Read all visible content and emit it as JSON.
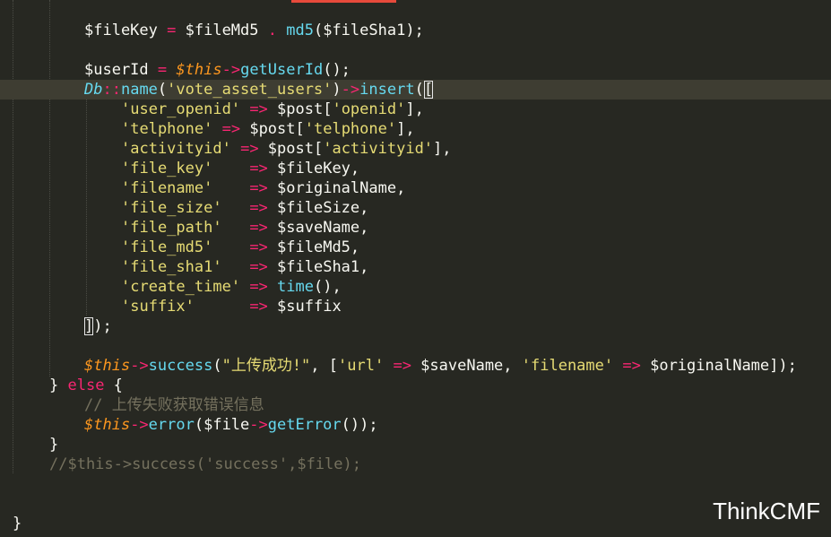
{
  "watermark": "ThinkCMF",
  "colors": {
    "background": "#272822",
    "active_line": "#3e3d32",
    "operator": "#f92672",
    "function": "#66d9ef",
    "string": "#e6db74",
    "this_var": "#fd971f",
    "comment": "#75715e",
    "plain": "#f8f8f2"
  },
  "code": {
    "l01": [
      {
        "text": "$fileKey",
        "cls": "v"
      },
      {
        "text": " ",
        "cls": "v"
      },
      {
        "text": "=",
        "cls": "op"
      },
      {
        "text": " $fileMd5 ",
        "cls": "v"
      },
      {
        "text": ".",
        "cls": "op"
      },
      {
        "text": " ",
        "cls": "v"
      },
      {
        "text": "md5",
        "cls": "fn"
      },
      {
        "text": "($fileSha1);",
        "cls": "v"
      }
    ],
    "l02": [
      {
        "text": "$userId",
        "cls": "v"
      },
      {
        "text": " ",
        "cls": "v"
      },
      {
        "text": "=",
        "cls": "op"
      },
      {
        "text": " ",
        "cls": "v"
      },
      {
        "text": "$this",
        "cls": "this"
      },
      {
        "text": "->",
        "cls": "op"
      },
      {
        "text": "getUserId",
        "cls": "fn"
      },
      {
        "text": "();",
        "cls": "v"
      }
    ],
    "l03": [
      {
        "text": "Db",
        "cls": "cls"
      },
      {
        "text": "::",
        "cls": "op"
      },
      {
        "text": "name",
        "cls": "fn"
      },
      {
        "text": "(",
        "cls": "v"
      },
      {
        "text": "'vote_asset_users'",
        "cls": "str"
      },
      {
        "text": ")",
        "cls": "v"
      },
      {
        "text": "->",
        "cls": "op"
      },
      {
        "text": "insert",
        "cls": "fn"
      },
      {
        "text": "(",
        "cls": "v"
      },
      {
        "text": "[",
        "cls": "brk"
      }
    ],
    "l04": [
      {
        "text": "'user_openid'",
        "cls": "str"
      },
      {
        "text": " ",
        "cls": "v"
      },
      {
        "text": "=>",
        "cls": "op"
      },
      {
        "text": " $post[",
        "cls": "v"
      },
      {
        "text": "'openid'",
        "cls": "str"
      },
      {
        "text": "],",
        "cls": "v"
      }
    ],
    "l05": [
      {
        "text": "'telphone'",
        "cls": "str"
      },
      {
        "text": " ",
        "cls": "v"
      },
      {
        "text": "=>",
        "cls": "op"
      },
      {
        "text": " $post[",
        "cls": "v"
      },
      {
        "text": "'telphone'",
        "cls": "str"
      },
      {
        "text": "],",
        "cls": "v"
      }
    ],
    "l06": [
      {
        "text": "'activityid'",
        "cls": "str"
      },
      {
        "text": " ",
        "cls": "v"
      },
      {
        "text": "=>",
        "cls": "op"
      },
      {
        "text": " $post[",
        "cls": "v"
      },
      {
        "text": "'activityid'",
        "cls": "str"
      },
      {
        "text": "],",
        "cls": "v"
      }
    ],
    "l07": [
      {
        "text": "'file_key'",
        "cls": "str"
      },
      {
        "text": "    ",
        "cls": "v"
      },
      {
        "text": "=>",
        "cls": "op"
      },
      {
        "text": " $fileKey,",
        "cls": "v"
      }
    ],
    "l08": [
      {
        "text": "'filename'",
        "cls": "str"
      },
      {
        "text": "    ",
        "cls": "v"
      },
      {
        "text": "=>",
        "cls": "op"
      },
      {
        "text": " $originalName,",
        "cls": "v"
      }
    ],
    "l09": [
      {
        "text": "'file_size'",
        "cls": "str"
      },
      {
        "text": "   ",
        "cls": "v"
      },
      {
        "text": "=>",
        "cls": "op"
      },
      {
        "text": " $fileSize,",
        "cls": "v"
      }
    ],
    "l10": [
      {
        "text": "'file_path'",
        "cls": "str"
      },
      {
        "text": "   ",
        "cls": "v"
      },
      {
        "text": "=>",
        "cls": "op"
      },
      {
        "text": " $saveName,",
        "cls": "v"
      }
    ],
    "l11": [
      {
        "text": "'file_md5'",
        "cls": "str"
      },
      {
        "text": "    ",
        "cls": "v"
      },
      {
        "text": "=>",
        "cls": "op"
      },
      {
        "text": " $fileMd5,",
        "cls": "v"
      }
    ],
    "l12": [
      {
        "text": "'file_sha1'",
        "cls": "str"
      },
      {
        "text": "   ",
        "cls": "v"
      },
      {
        "text": "=>",
        "cls": "op"
      },
      {
        "text": " $fileSha1,",
        "cls": "v"
      }
    ],
    "l13": [
      {
        "text": "'create_time'",
        "cls": "str"
      },
      {
        "text": " ",
        "cls": "v"
      },
      {
        "text": "=>",
        "cls": "op"
      },
      {
        "text": " ",
        "cls": "v"
      },
      {
        "text": "time",
        "cls": "fn"
      },
      {
        "text": "(),",
        "cls": "v"
      }
    ],
    "l14": [
      {
        "text": "'suffix'",
        "cls": "str"
      },
      {
        "text": "      ",
        "cls": "v"
      },
      {
        "text": "=>",
        "cls": "op"
      },
      {
        "text": " $suffix",
        "cls": "v"
      }
    ],
    "l15": [
      {
        "text": "]",
        "cls": "brk"
      },
      {
        "text": ");",
        "cls": "v"
      }
    ],
    "l16": [
      {
        "text": "$this",
        "cls": "this"
      },
      {
        "text": "->",
        "cls": "op"
      },
      {
        "text": "success",
        "cls": "fn"
      },
      {
        "text": "(",
        "cls": "v"
      },
      {
        "text": "\"上传成功!\"",
        "cls": "str"
      },
      {
        "text": ", [",
        "cls": "v"
      },
      {
        "text": "'url'",
        "cls": "str"
      },
      {
        "text": " ",
        "cls": "v"
      },
      {
        "text": "=>",
        "cls": "op"
      },
      {
        "text": " $saveName, ",
        "cls": "v"
      },
      {
        "text": "'filename'",
        "cls": "str"
      },
      {
        "text": " ",
        "cls": "v"
      },
      {
        "text": "=>",
        "cls": "op"
      },
      {
        "text": " $originalName]);",
        "cls": "v"
      }
    ],
    "l17": [
      {
        "text": "} ",
        "cls": "v"
      },
      {
        "text": "else",
        "cls": "kw"
      },
      {
        "text": " {",
        "cls": "v"
      }
    ],
    "l18": [
      {
        "text": "// 上传失败获取错误信息",
        "cls": "cmt"
      }
    ],
    "l19": [
      {
        "text": "$this",
        "cls": "this"
      },
      {
        "text": "->",
        "cls": "op"
      },
      {
        "text": "error",
        "cls": "fn"
      },
      {
        "text": "($file",
        "cls": "v"
      },
      {
        "text": "->",
        "cls": "op"
      },
      {
        "text": "getError",
        "cls": "fn"
      },
      {
        "text": "());",
        "cls": "v"
      }
    ],
    "l20": [
      {
        "text": "}",
        "cls": "v"
      }
    ],
    "l21": [
      {
        "text": "//$this->success('success',$file);",
        "cls": "cmt"
      }
    ],
    "l22": [
      {
        "text": "}",
        "cls": "v"
      }
    ]
  }
}
